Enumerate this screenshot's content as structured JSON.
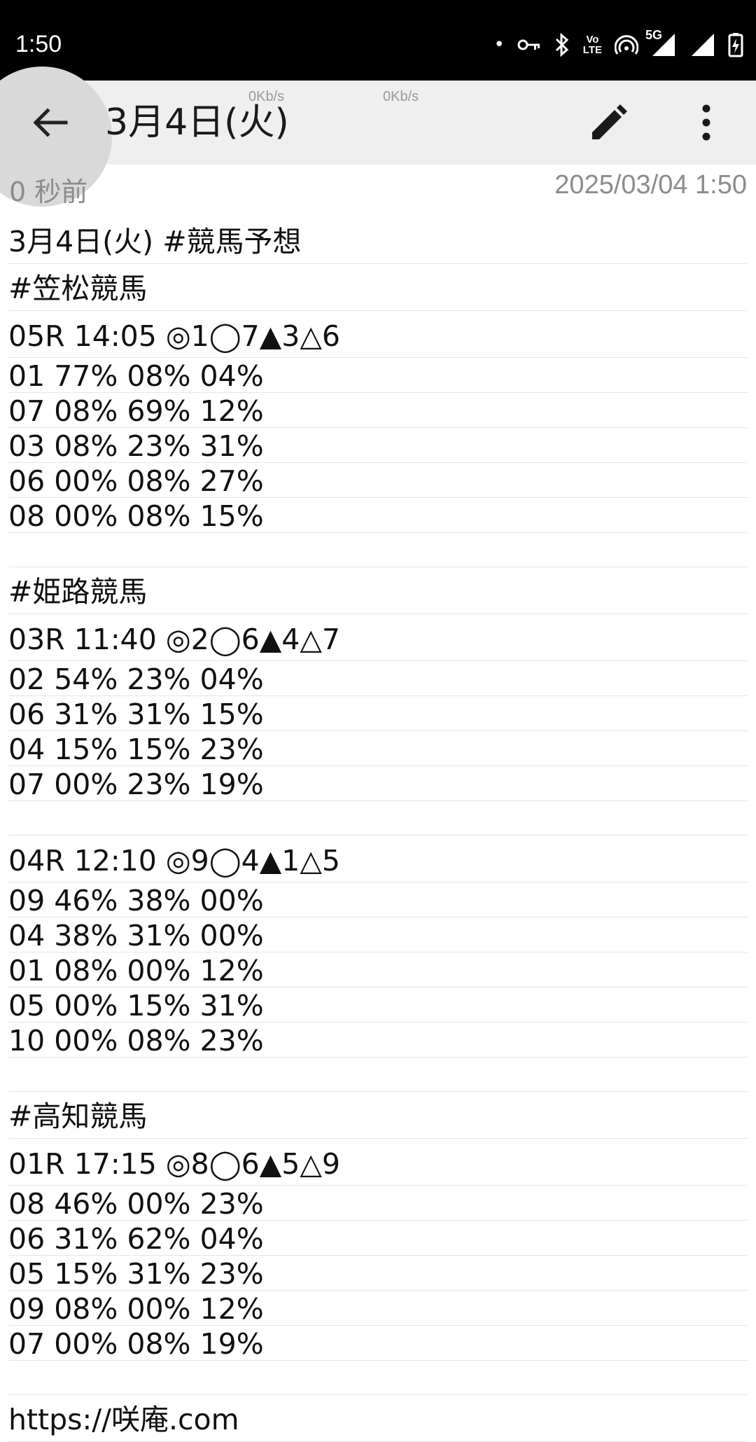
{
  "status_bar": {
    "time": "1:50",
    "dot": "•",
    "network_label_top": "Vo",
    "network_label_bottom": "LTE",
    "fiveg": "5G"
  },
  "app_bar": {
    "title": "3月4日(火)",
    "netspeed_1": "0Kb/s",
    "netspeed_2": "0Kb/s"
  },
  "meta": {
    "relative_time": "0 秒前",
    "timestamp": "2025/03/04 1:50"
  },
  "note_lines": [
    "3月4日(火) #競馬予想",
    "#笠松競馬",
    "05R 14:05 ◎1◯7▲3△6",
    "01 77% 08% 04%",
    "07 08% 69% 12%",
    "03 08% 23% 31%",
    "06 00% 08% 27%",
    "08 00% 08% 15%",
    "",
    "#姫路競馬",
    "03R 11:40 ◎2◯6▲4△7",
    "02 54% 23% 04%",
    "06 31% 31% 15%",
    "04 15% 15% 23%",
    "07 00% 23% 19%",
    "",
    "04R 12:10 ◎9◯4▲1△5",
    "09 46% 38% 00%",
    "04 38% 31% 00%",
    "01 08% 00% 12%",
    "05 00% 15% 31%",
    "10 00% 08% 23%",
    "",
    "#高知競馬",
    "01R 17:15 ◎8◯6▲5△9",
    "08 46% 00% 23%",
    "06 31% 62% 04%",
    "05 15% 31% 23%",
    "09 08% 00% 12%",
    "07 00% 08% 19%",
    "",
    "https://咲庵.com"
  ]
}
